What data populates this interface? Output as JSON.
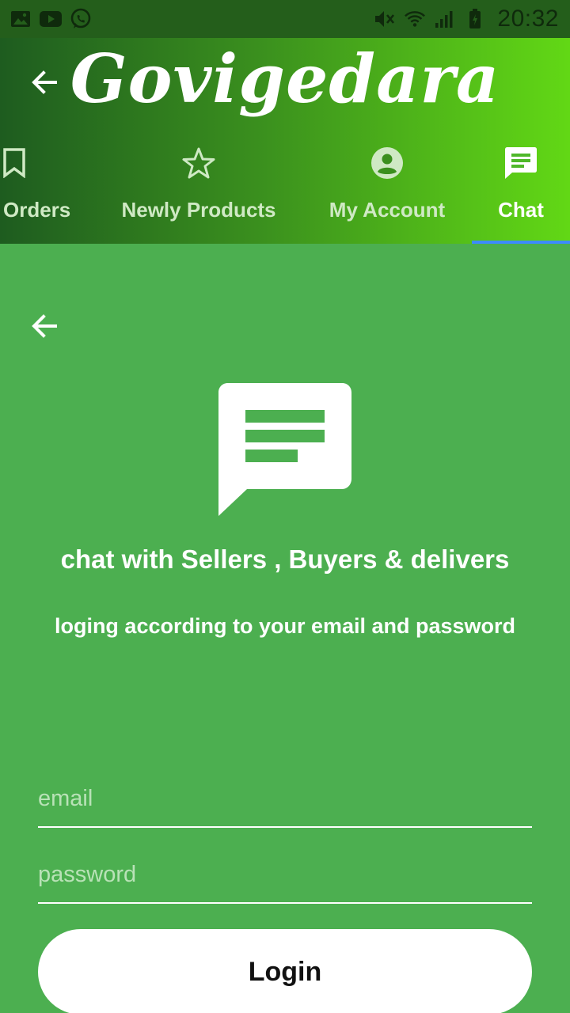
{
  "status_bar": {
    "time": "20:32",
    "left_icons": [
      "gallery-icon",
      "youtube-icon",
      "whatsapp-icon"
    ],
    "right_icons": [
      "mute-icon",
      "wifi-icon",
      "signal-icon",
      "battery-icon"
    ]
  },
  "app_bar": {
    "title": "Govigedara",
    "back_icon": "arrow-back-icon"
  },
  "tabs": [
    {
      "label": "Orders",
      "icon": "bookmark-icon",
      "active": false
    },
    {
      "label": "Newly Products",
      "icon": "star-icon",
      "active": false
    },
    {
      "label": "My Account",
      "icon": "account-circle-icon",
      "active": false
    },
    {
      "label": "Chat",
      "icon": "chat-icon",
      "active": true
    }
  ],
  "content": {
    "back_icon": "arrow-back-icon",
    "illustration_icon": "chat-icon",
    "headline": "chat with Sellers , Buyers & delivers",
    "subline": "loging according to your email and password",
    "email_placeholder": "email",
    "password_placeholder": "password",
    "login_label": "Login"
  },
  "colors": {
    "background": "#4caf50",
    "status_bar": "#245e1b",
    "header_start": "#1e5c1f",
    "header_end": "#62d815",
    "tab_indicator": "#3d8bfd",
    "button": "#ffffff"
  }
}
